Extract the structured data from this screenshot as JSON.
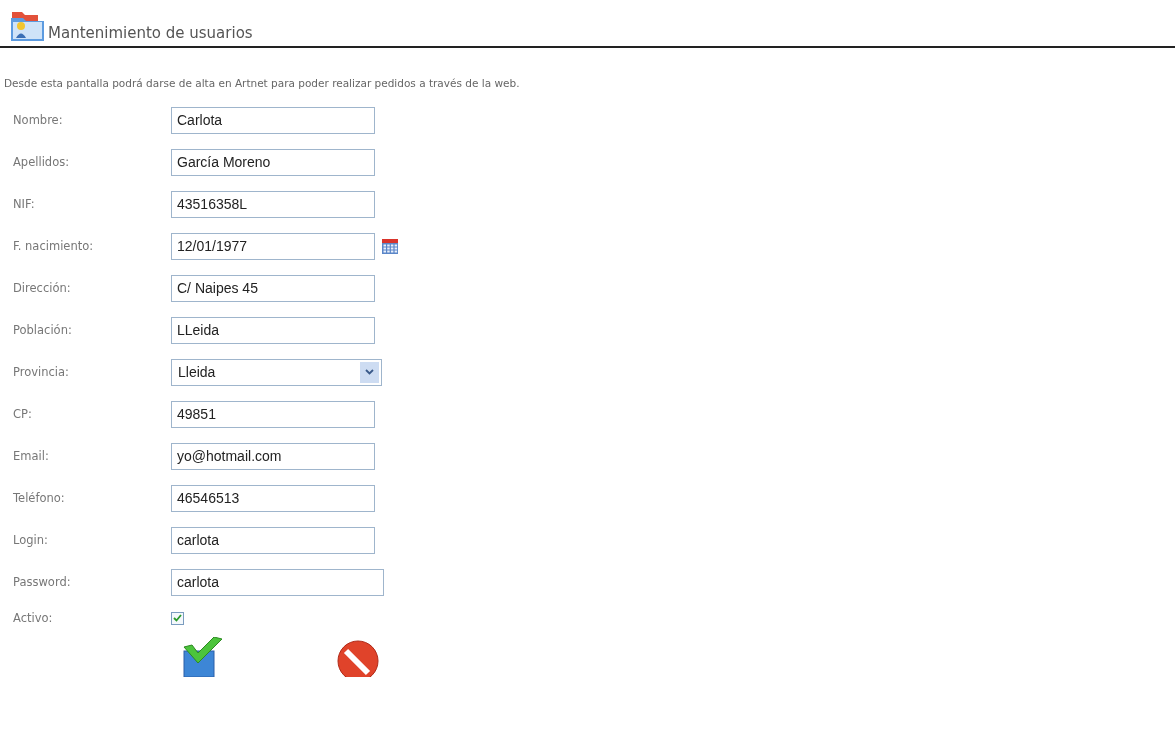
{
  "header": {
    "title": "Mantenimiento de usuarios"
  },
  "description": "Desde esta pantalla podrá darse de alta en Artnet para poder realizar pedidos a través de la web.",
  "fields": [
    {
      "kind": "text",
      "label": "Nombre:",
      "value": "Carlota"
    },
    {
      "kind": "text",
      "label": "Apellidos:",
      "value": "García Moreno"
    },
    {
      "kind": "text",
      "label": "NIF:",
      "value": "43516358L"
    },
    {
      "kind": "date",
      "label": "F. nacimiento:",
      "value": "12/01/1977"
    },
    {
      "kind": "text",
      "label": "Dirección:",
      "value": "C/ Naipes 45"
    },
    {
      "kind": "text",
      "label": "Población:",
      "value": "LLeida"
    },
    {
      "kind": "select",
      "label": "Provincia:",
      "value": "Lleida"
    },
    {
      "kind": "text",
      "label": "CP:",
      "value": "49851"
    },
    {
      "kind": "text",
      "label": "Email:",
      "value": "yo@hotmail.com"
    },
    {
      "kind": "text",
      "label": "Teléfono:",
      "value": "46546513"
    },
    {
      "kind": "text",
      "label": "Login:",
      "value": "carlota"
    },
    {
      "kind": "wide",
      "label": "Password:",
      "value": "carlota"
    },
    {
      "kind": "checkbox",
      "label": "Activo:",
      "checked": true
    }
  ]
}
